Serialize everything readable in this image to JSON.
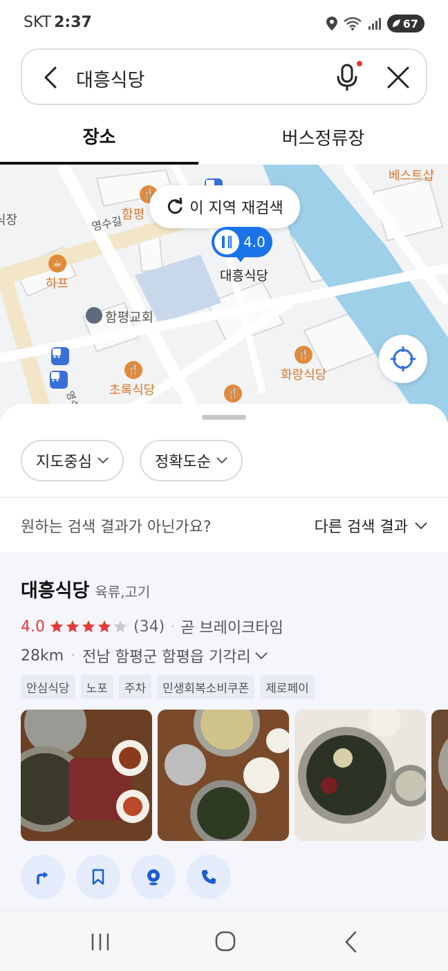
{
  "status_bar": {
    "carrier": "SKT",
    "time": "2:37",
    "battery": "67"
  },
  "search": {
    "query": "대흥식당"
  },
  "tabs": [
    {
      "label": "장소"
    },
    {
      "label": "버스정류장"
    }
  ],
  "map": {
    "rescan_label": "이 지역 재검색",
    "pin": {
      "rating": "4.0",
      "name": "대흥식당"
    },
    "labels": {
      "best_shop": "베스트샵",
      "hampyeong": "함평",
      "sik_dang": "식장",
      "yeongsu_gil": "영수길",
      "hap": "하프",
      "church": "함평교회",
      "hwarang": "화랑식당",
      "chorok": "초록식당",
      "road_sign": "영수"
    }
  },
  "filters": [
    {
      "label": "지도중심"
    },
    {
      "label": "정확도순"
    }
  ],
  "alt_results": {
    "question": "원하는 검색 결과가 아닌가요?",
    "link": "다른 검색 결과"
  },
  "result": {
    "name": "대흥식당",
    "category": "육류,고기",
    "rating": "4.0",
    "stars_filled": 4,
    "review_count": "(34)",
    "status": "곧 브레이크타임",
    "distance": "28km",
    "address": "전남 함평군 함평읍 기각리",
    "tags": [
      "안심식당",
      "노포",
      "주차",
      "민생회복소비쿠폰",
      "제로페이"
    ],
    "actions": [
      "directions-icon",
      "bookmark-icon",
      "location-pin-icon",
      "phone-icon"
    ]
  },
  "colors": {
    "accent": "#1a73e8",
    "rating": "#e53935",
    "poi": "#d9772b",
    "river": "#9fd0ea"
  }
}
